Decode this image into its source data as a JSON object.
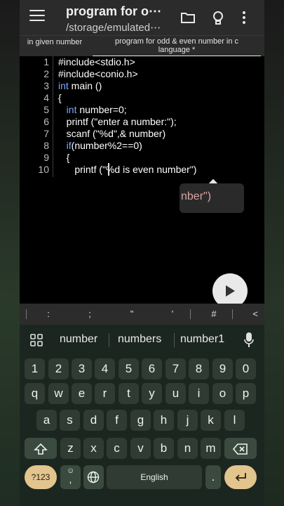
{
  "appbar": {
    "title": "program for o⋯",
    "subtitle": "/storage/emulated⋯"
  },
  "tabs": {
    "tab1": "in given number",
    "tab2_line1": "program for odd & even number in c",
    "tab2_line2": "language *"
  },
  "editor": {
    "line_numbers": [
      "1",
      "2",
      "3",
      "4",
      "5",
      "6",
      "7",
      "8",
      "9",
      "10"
    ],
    "lines": [
      "#include<stdio.h>",
      "#include<conio.h>",
      "int main ()",
      "{",
      "   int number=0;",
      "   printf (\"enter a number:\");",
      "   scanf (\"%d\",& number)",
      "   if(number%2==0)",
      "   {",
      "      printf (\"%d is even number\")"
    ],
    "popup_text": "nber\")"
  },
  "symbols": [
    ":",
    ";",
    "\"",
    "'",
    "#",
    "<"
  ],
  "suggestions": [
    "number",
    "numbers",
    "number1"
  ],
  "keyboard": {
    "row1": [
      "1",
      "2",
      "3",
      "4",
      "5",
      "6",
      "7",
      "8",
      "9",
      "0"
    ],
    "row2": [
      "q",
      "w",
      "e",
      "r",
      "t",
      "y",
      "u",
      "i",
      "o",
      "p"
    ],
    "row3": [
      "a",
      "s",
      "d",
      "f",
      "g",
      "h",
      "j",
      "k",
      "l"
    ],
    "row4": [
      "z",
      "x",
      "c",
      "v",
      "b",
      "n",
      "m"
    ],
    "sym_key": "?123",
    "comma": ",",
    "space": "English",
    "period": "."
  },
  "colors": {
    "accent_key": "#e2c48d",
    "keyword": "#7aa9ff",
    "keyboard_bg": "#1c2620"
  }
}
